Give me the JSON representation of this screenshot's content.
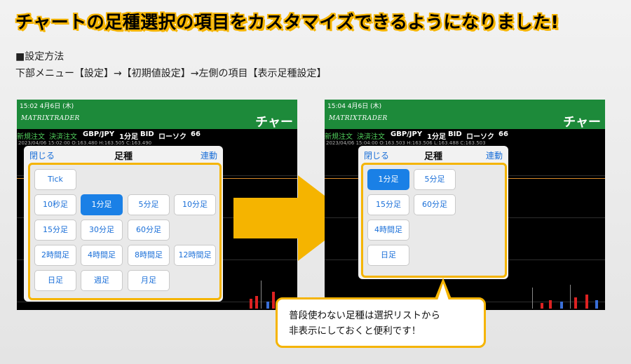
{
  "headline": "チャートの足種選択の項目をカスタマイズできるようになりました!",
  "method_title": "■設定方法",
  "method_path": "下部メニュー【設定】→【初期値設定】→左側の項目【表示足種設定】",
  "left_screen": {
    "status": "15:02   4月6日 (木)",
    "brand": "MATRIXTRADER",
    "title": "チャー",
    "toolbar": {
      "new_order": "新規注文",
      "settle_order": "決済注文",
      "pair": "GBP/JPY",
      "interval": "1分足",
      "side": "BID",
      "candle": "ローソク",
      "count": "66"
    },
    "info": "2023/04/06 15:02:00   O:163.480   H:163.505   C:163.490"
  },
  "right_screen": {
    "status": "15:04   4月6日 (木)",
    "brand": "MATRIXTRADER",
    "title": "チャー",
    "toolbar": {
      "new_order": "新規注文",
      "settle_order": "決済注文",
      "pair": "GBP/JPY",
      "interval": "1分足",
      "side": "BID",
      "candle": "ローソク",
      "count": "66"
    },
    "info": "2023/04/06 15:04:00   O:163.503   H:163.506   L:163.488   C:163.503"
  },
  "panel": {
    "close": "閉じる",
    "title": "足種",
    "link": "連動"
  },
  "left_buttons": [
    "Tick",
    "10秒足",
    "1分足",
    "5分足",
    "10分足",
    "15分足",
    "30分足",
    "60分足",
    "2時間足",
    "4時間足",
    "8時間足",
    "12時間足",
    "日足",
    "週足",
    "月足"
  ],
  "right_buttons": [
    "1分足",
    "5分足",
    "15分足",
    "60分足",
    "4時間足",
    "日足"
  ],
  "selected": "1分足",
  "callout": {
    "line1": "普段使わない足種は選択リストから",
    "line2": "非表示にしておくと便利です！"
  },
  "colors": {
    "accent": "#f5b400",
    "green": "#1d8a3a",
    "blue": "#1a6fd8"
  }
}
